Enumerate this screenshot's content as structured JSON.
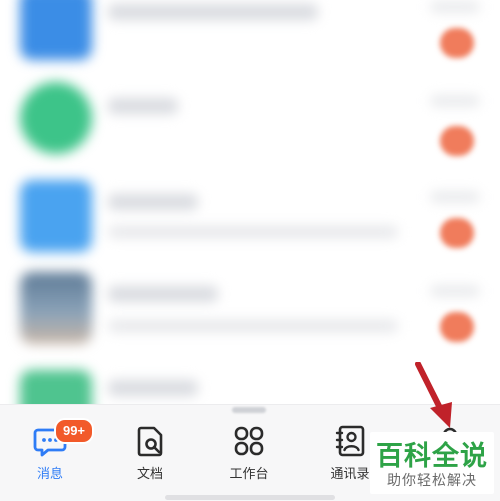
{
  "chat_list": [
    {
      "avatar_color": "#3b8de6",
      "has_unread": true
    },
    {
      "avatar_color": "#3dc489",
      "has_unread": true
    },
    {
      "avatar_color": "#4aa3f0",
      "has_unread": true
    },
    {
      "avatar_color": "#6c8aa6",
      "has_unread": true
    },
    {
      "avatar_color": "#4fc48f",
      "has_unread": false
    }
  ],
  "tab_bar": {
    "messages": {
      "label": "消息",
      "icon": "chat-bubble-icon",
      "badge": "99+"
    },
    "docs": {
      "label": "文档",
      "icon": "document-icon"
    },
    "workbench": {
      "label": "工作台",
      "icon": "grid-icon"
    },
    "contacts": {
      "label": "通讯录",
      "icon": "contacts-icon"
    },
    "me": {
      "label": "",
      "icon": "person-icon"
    }
  },
  "watermark": {
    "title": "百科全说",
    "subtitle": "助你轻松解决"
  },
  "colors": {
    "accent": "#2e7cf6",
    "badge": "#f25a2a",
    "arrow": "#c0222a",
    "watermark": "#2ea347"
  }
}
